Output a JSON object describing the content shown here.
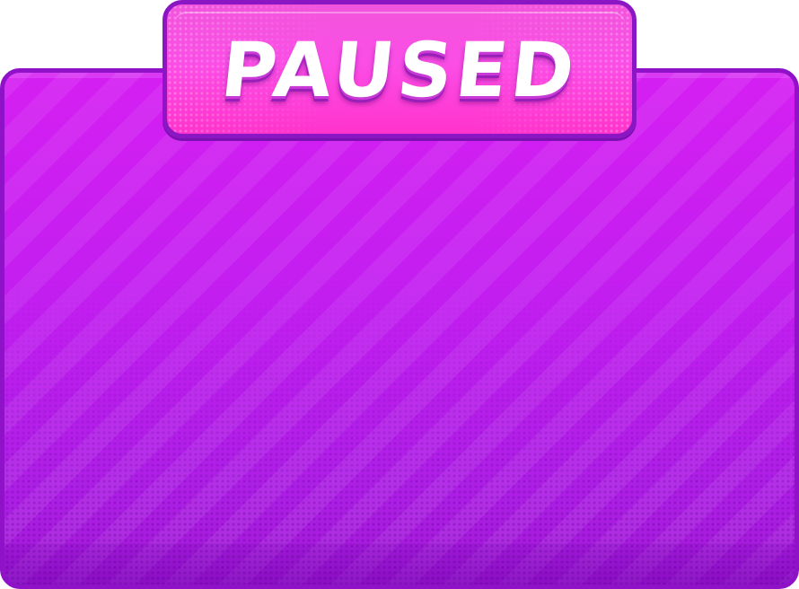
{
  "dialog": {
    "title": "PAUSED"
  },
  "colors": {
    "panel_fill": "#c21ef0",
    "panel_border": "#8f12c9",
    "tab_fill": "#fb4ee6",
    "tab_border": "#8a16c4",
    "title_text": "#ffffff"
  }
}
